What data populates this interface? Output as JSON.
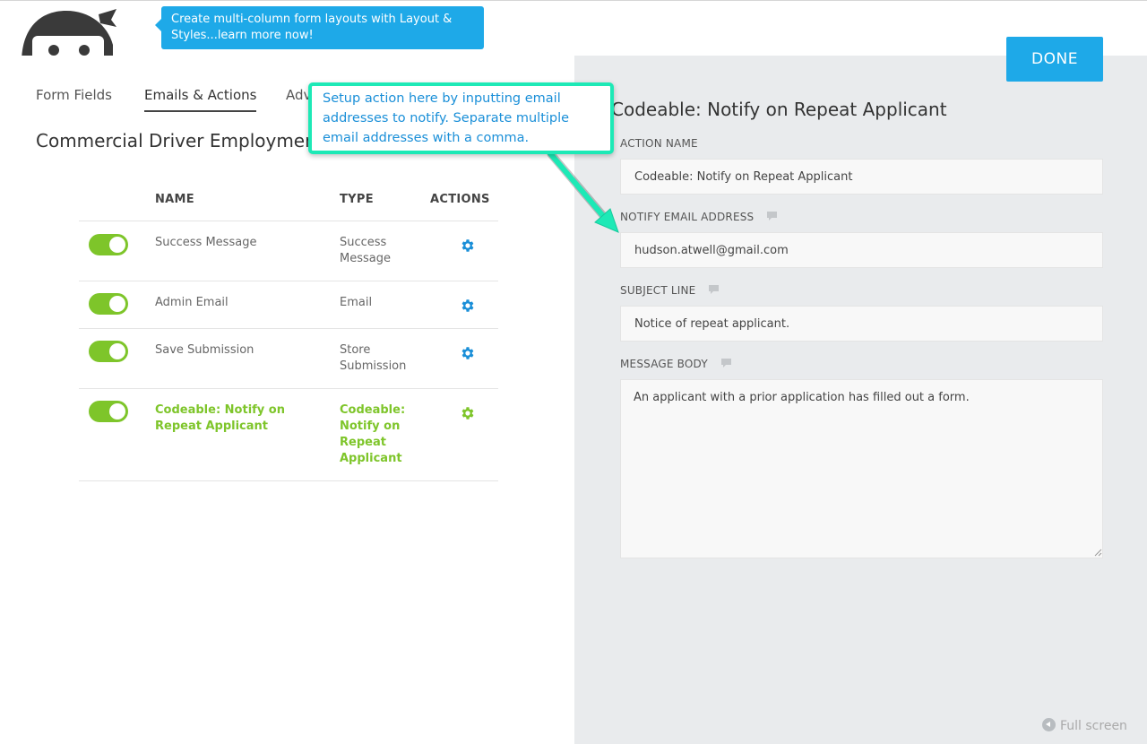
{
  "promo": {
    "text": "Create multi-column form layouts with Layout & Styles...learn more now!"
  },
  "tabs": [
    {
      "label": "Form Fields"
    },
    {
      "label": "Emails & Actions"
    },
    {
      "label": "Adv"
    }
  ],
  "form_title": "Commercial Driver Employment",
  "table": {
    "headers": {
      "name": "NAME",
      "type": "TYPE",
      "actions": "ACTIONS"
    },
    "rows": [
      {
        "name": "Success Message",
        "type": "Success Message",
        "enabled": true,
        "highlight": false
      },
      {
        "name": "Admin Email",
        "type": "Email",
        "enabled": true,
        "highlight": false
      },
      {
        "name": "Save Submission",
        "type": "Store Submission",
        "enabled": true,
        "highlight": false
      },
      {
        "name": "Codeable: Notify on Repeat Applicant",
        "type": "Codeable: Notify on Repeat Applicant",
        "enabled": true,
        "highlight": true
      }
    ]
  },
  "callout": {
    "text": "Setup action here by inputting email addresses to notify. Separate multiple email addresses with a comma."
  },
  "done_label": "DONE",
  "action_title": "Codeable: Notify on Repeat Applicant",
  "fields": {
    "action_name": {
      "label": "ACTION NAME",
      "value": "Codeable: Notify on Repeat Applicant"
    },
    "notify_email": {
      "label": "NOTIFY EMAIL ADDRESS",
      "value": "hudson.atwell@gmail.com"
    },
    "subject": {
      "label": "SUBJECT LINE",
      "value": "Notice of repeat applicant."
    },
    "message": {
      "label": "MESSAGE BODY",
      "value": "An applicant with a prior application has filled out a form."
    }
  },
  "fullscreen_label": "Full screen",
  "colors": {
    "accent_blue": "#1ea9e8",
    "toggle_green": "#7ec52a",
    "callout_border": "#1de9b6",
    "gear_blue": "#1a8fd8"
  }
}
